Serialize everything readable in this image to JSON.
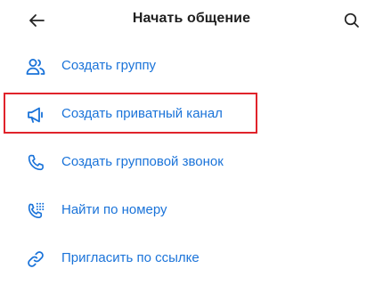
{
  "header": {
    "title": "Начать общение",
    "back_icon": "arrow-left-icon",
    "search_icon": "search-icon"
  },
  "menu": {
    "items": [
      {
        "label": "Создать группу",
        "icon": "group-icon"
      },
      {
        "label": "Создать приватный канал",
        "icon": "megaphone-icon"
      },
      {
        "label": "Создать групповой звонок",
        "icon": "phone-icon"
      },
      {
        "label": "Найти по номеру",
        "icon": "phone-keypad-icon"
      },
      {
        "label": "Пригласить по ссылке",
        "icon": "link-icon"
      }
    ]
  },
  "colors": {
    "accent": "#1a73d9",
    "title": "#1f1f1f",
    "highlight": "#e0232b",
    "background": "#ffffff"
  }
}
